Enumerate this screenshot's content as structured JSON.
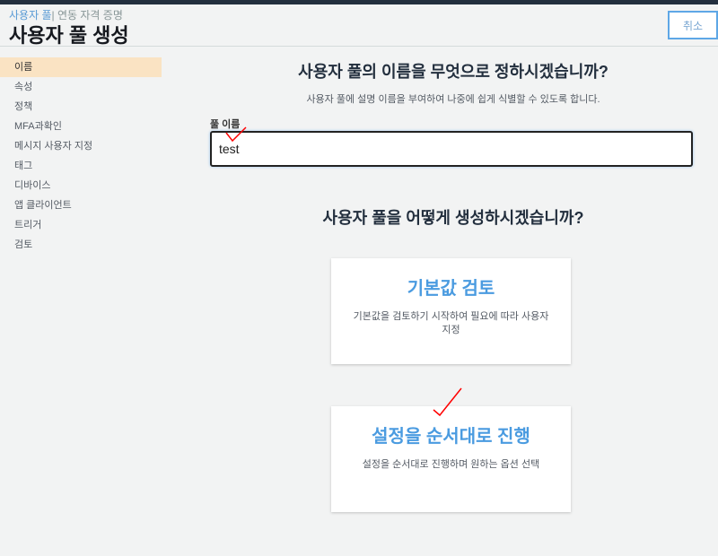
{
  "header": {
    "breadcrumb": [
      "사용자 풀",
      "연동 자격 증명"
    ],
    "separator": "|",
    "title": "사용자 풀 생성",
    "cancel_label": "취소"
  },
  "sidebar": {
    "items": [
      {
        "label": "이름",
        "active": true
      },
      {
        "label": "속성"
      },
      {
        "label": "정책"
      },
      {
        "label": "MFA과확인"
      },
      {
        "label": "메시지 사용자 지정"
      },
      {
        "label": "태그"
      },
      {
        "label": "디바이스"
      },
      {
        "label": "앱 클라이언트"
      },
      {
        "label": "트리거"
      },
      {
        "label": "검토"
      }
    ]
  },
  "main": {
    "name_heading": "사용자 풀의 이름을 무엇으로 정하시겠습니까?",
    "name_subtext": "사용자 풀에 설명 이름을 부여하여 나중에 쉽게 식별할 수 있도록 합니다.",
    "pool_name_label": "풀 이름",
    "pool_name_value": "test",
    "create_heading": "사용자 풀을 어떻게 생성하시겠습니까?",
    "options": [
      {
        "title": "기본값 검토",
        "desc": "기본값을 검토하기 시작하여 필요에 따라 사용자 지정"
      },
      {
        "title": "설정을 순서대로 진행",
        "desc": "설정을 순서대로 진행하며 원하는 옵션 선택"
      }
    ]
  },
  "colors": {
    "accent": "#4a9be0",
    "active_nav": "#fae3c3",
    "topbar": "#232f3e",
    "annotation": "#ff0000"
  }
}
